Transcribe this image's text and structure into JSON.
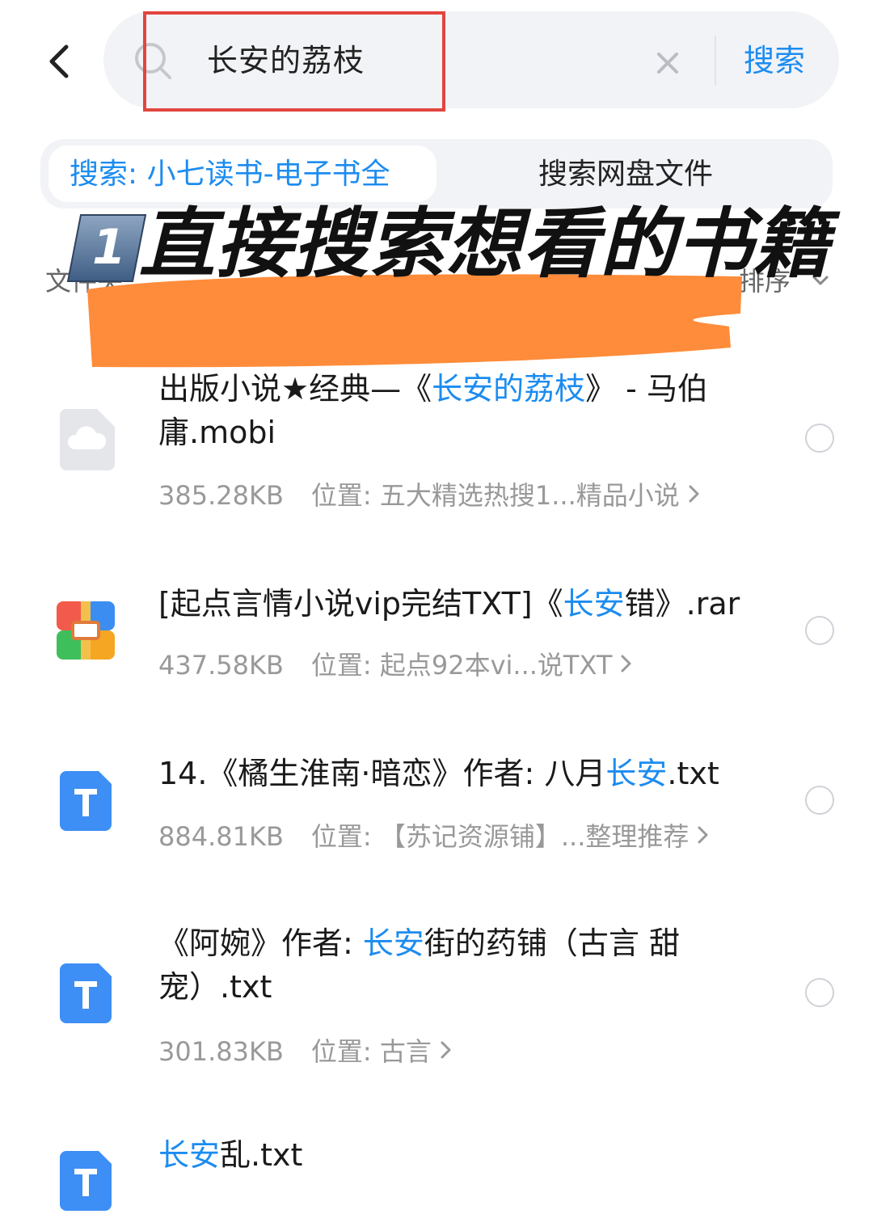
{
  "header": {
    "back_icon": "chevron-left-icon",
    "search_query": "长安的荔枝",
    "search_button": "搜索",
    "clear_icon": "close-icon"
  },
  "tabs": [
    {
      "label": "搜索: 小七读书-电子书全",
      "active": true
    },
    {
      "label": "搜索网盘文件",
      "active": false
    }
  ],
  "filters": {
    "left_label": "文件夹",
    "sort_label": "排序"
  },
  "overlay": {
    "badge": "1",
    "title": "直接搜索想看的书籍",
    "stroke_color": "#ff8c3a"
  },
  "accent_color": "#1c8cf0",
  "files": [
    {
      "name_parts": [
        "出版小说★经典—《",
        "长安的荔枝",
        "》 - 马伯庸.mobi"
      ],
      "size": "385.28KB",
      "location": "位置: 五大精选热搜1...精品小说",
      "icon": "cloud-file-icon"
    },
    {
      "name_parts": [
        "[起点言情小说vip完结TXT]《",
        "长安",
        "错》.rar"
      ],
      "size": "437.58KB",
      "location": "位置: 起点92本vi...说TXT",
      "icon": "archive-file-icon"
    },
    {
      "name_parts": [
        "14.《橘生淮南·暗恋》作者: 八月",
        "长安",
        ".txt"
      ],
      "size": "884.81KB",
      "location": "位置: 【苏记资源铺】...整理推荐",
      "icon": "text-file-icon"
    },
    {
      "name_parts": [
        "《阿婉》作者: ",
        "长安",
        "街的药铺（古言 甜宠）.txt"
      ],
      "size": "301.83KB",
      "location": "位置: 古言",
      "icon": "text-file-icon"
    },
    {
      "name_parts": [
        "",
        "长安",
        "乱.txt"
      ],
      "size": "",
      "location": "",
      "icon": "text-file-icon"
    }
  ]
}
